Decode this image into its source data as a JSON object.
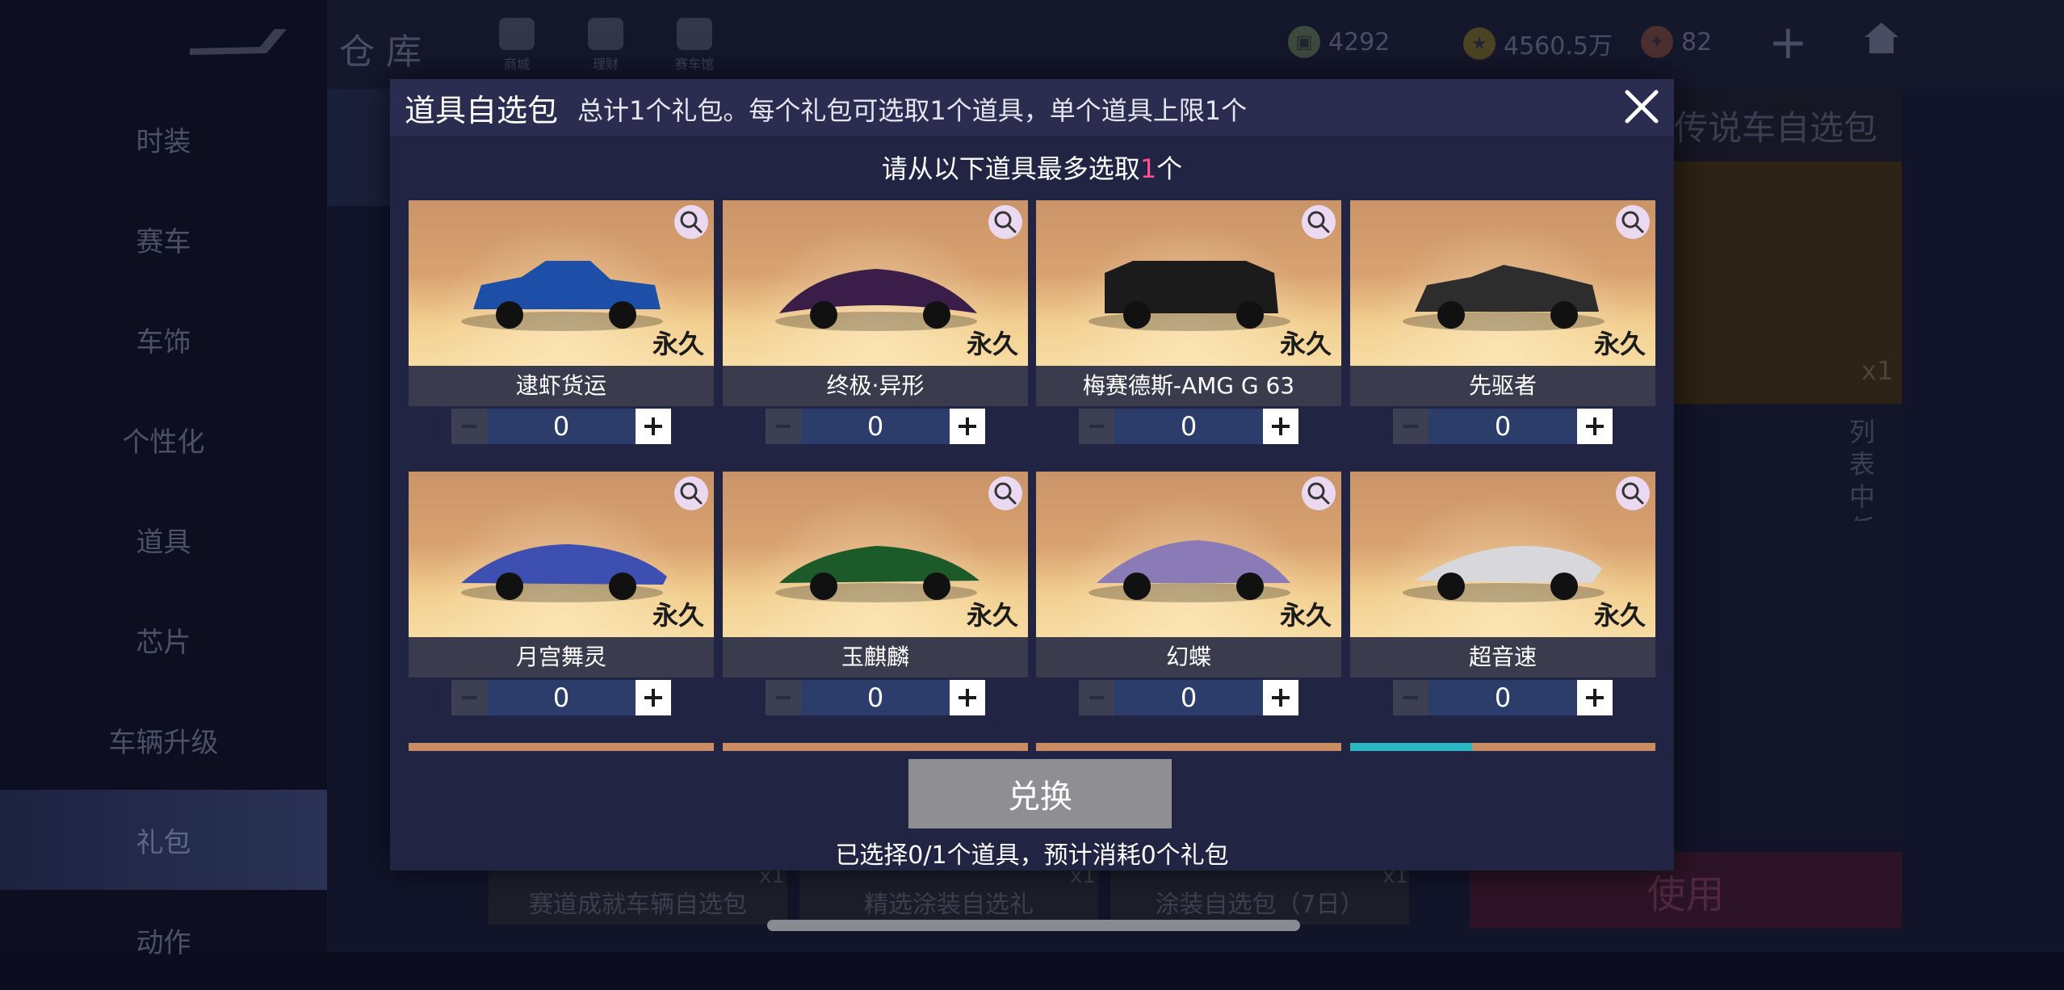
{
  "background": {
    "sidebar": [
      "时装",
      "赛车",
      "车饰",
      "个性化",
      "道具",
      "芯片",
      "车辆升级",
      "礼包",
      "动作"
    ],
    "active_sidebar_index": 7,
    "page_title": "仓库",
    "top_icons": [
      "商城",
      "理财",
      "赛车馆"
    ],
    "currencies": [
      "4292",
      "4560.5万",
      "82"
    ],
    "right_panel": {
      "title": "传说车自选包",
      "count": "x1",
      "description": "列表中任选一个永久传说蓝图自选部分传说、黑金",
      "use_button": "使用"
    },
    "bottom_cards": [
      {
        "label": "赛道成就车辆自选包",
        "count": "x1"
      },
      {
        "label": "精选涂装自选礼",
        "count": "x1"
      },
      {
        "label": "涂装自选包（7日）",
        "count": "x1"
      }
    ]
  },
  "modal": {
    "title": "道具自选包",
    "subtitle": "总计1个礼包。每个礼包可选取1个道具，单个道具上限1个",
    "instruction_prefix": "请从以下道具最多选取",
    "instruction_count": "1",
    "instruction_suffix": "个",
    "items": [
      {
        "name": "逮虾货运",
        "duration": "永久",
        "quantity": "0",
        "color": "#1d4fa8"
      },
      {
        "name": "终极·异形",
        "duration": "永久",
        "quantity": "0",
        "color": "#3b1d4a"
      },
      {
        "name": "梅赛德斯-AMG G 63",
        "duration": "永久",
        "quantity": "0",
        "color": "#1b1b1b"
      },
      {
        "name": "先驱者",
        "duration": "永久",
        "quantity": "0",
        "color": "#2d2d2d"
      },
      {
        "name": "月宫舞灵",
        "duration": "永久",
        "quantity": "0",
        "color": "#3d4fb0"
      },
      {
        "name": "玉麒麟",
        "duration": "永久",
        "quantity": "0",
        "color": "#1d5a2a"
      },
      {
        "name": "幻蝶",
        "duration": "永久",
        "quantity": "0",
        "color": "#8a7ab6"
      },
      {
        "name": "超音速",
        "duration": "永久",
        "quantity": "0",
        "color": "#d8d8dc"
      }
    ],
    "exchange_button": "兑换",
    "summary": "已选择0/1个道具，预计消耗0个礼包"
  }
}
